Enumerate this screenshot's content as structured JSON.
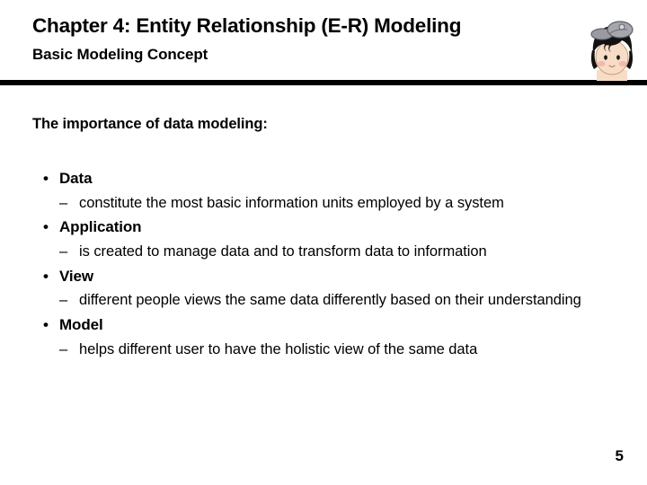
{
  "slide": {
    "title": "Chapter 4: Entity Relationship (E-R) Modeling",
    "subtitle": "Basic Modeling Concept",
    "rule_color": "#000000",
    "background_color": "#FFFFFF",
    "text_color": "#000000"
  },
  "avatar": {
    "name": "cartoon-student-head",
    "hair_color": "#111111",
    "skin_color": "#F7DCC6",
    "cheek_color": "#F3B3A4",
    "cap_color": "#9A9AA2",
    "cap_shadow_color": "#6E6E77"
  },
  "content": {
    "lead": "The importance of data modeling:",
    "bullets": [
      {
        "marker": "•",
        "label": "Data",
        "sub": [
          {
            "marker": "–",
            "text": "constitute the most basic information units employed by a system"
          }
        ]
      },
      {
        "marker": "•",
        "label": "Application",
        "sub": [
          {
            "marker": "–",
            "text": "is created to manage data and to transform data to information"
          }
        ]
      },
      {
        "marker": "•",
        "label": "View",
        "sub": [
          {
            "marker": "–",
            "text": "different people views the same data differently based on their understanding"
          }
        ]
      },
      {
        "marker": "•",
        "label": "Model",
        "sub": [
          {
            "marker": "–",
            "text": "helps different user to have the holistic view of the same data"
          }
        ]
      }
    ]
  },
  "footer": {
    "page_number": "5"
  }
}
